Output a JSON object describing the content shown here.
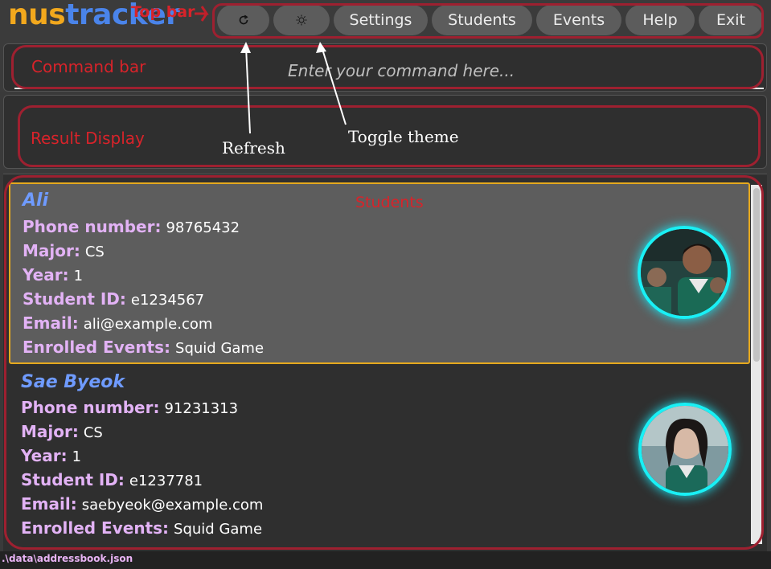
{
  "app": {
    "logo_part1": "nus",
    "logo_part2": "tracker"
  },
  "topbar": {
    "buttons": [
      {
        "icon": "refresh-icon"
      },
      {
        "icon": "theme-toggle-icon"
      },
      {
        "label": "Settings"
      },
      {
        "label": "Students"
      },
      {
        "label": "Events"
      },
      {
        "label": "Help"
      },
      {
        "label": "Exit"
      }
    ]
  },
  "command": {
    "placeholder": "Enter your command here..."
  },
  "annotations": {
    "top_bar": "Top bar",
    "command_bar": "Command bar",
    "result_display": "Result Display",
    "students": "Students",
    "refresh": "Refresh",
    "toggle_theme": "Toggle theme"
  },
  "students": [
    {
      "name": "Ali",
      "phone_label": "Phone number:",
      "phone": "98765432",
      "major_label": "Major:",
      "major": "CS",
      "year_label": "Year:",
      "year": "1",
      "id_label": "Student ID:",
      "id": "e1234567",
      "email_label": "Email:",
      "email": "ali@example.com",
      "events_label": "Enrolled Events:",
      "events": "Squid Game"
    },
    {
      "name": "Sae Byeok",
      "phone_label": "Phone number:",
      "phone": "91231313",
      "major_label": "Major:",
      "major": "CS",
      "year_label": "Year:",
      "year": "1",
      "id_label": "Student ID:",
      "id": "e1237781",
      "email_label": "Email:",
      "email": "saebyeok@example.com",
      "events_label": "Enrolled Events:",
      "events": "Squid Game"
    }
  ],
  "status": {
    "file_path": ".\\data\\addressbook.json"
  },
  "colors": {
    "accent_orange": "#f2a81d",
    "accent_blue": "#4a84ea",
    "label_purple": "#e2b2f5",
    "annotation_red": "#9e2030",
    "avatar_ring": "#19f0f5"
  }
}
